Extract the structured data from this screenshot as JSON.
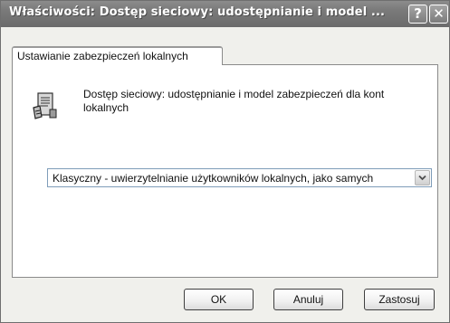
{
  "window": {
    "title": "Właściwości: Dostęp sieciowy: udostępnianie i model ...",
    "help_button": "?",
    "close_button": "✕"
  },
  "tab": {
    "label": "Ustawianie zabezpieczeń lokalnych"
  },
  "policy": {
    "icon": "policy-document-icon",
    "description": "Dostęp sieciowy: udostępnianie i model zabezpieczeń dla kont lokalnych"
  },
  "setting": {
    "selected_value": "Klasyczny - uwierzytelnianie użytkowników lokalnych, jako samych"
  },
  "buttons": {
    "ok": "OK",
    "cancel": "Anuluj",
    "apply": "Zastosuj"
  }
}
